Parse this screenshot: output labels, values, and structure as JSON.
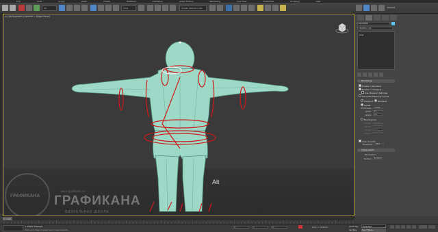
{
  "menu": {
    "items": [
      "Edit",
      "Tools",
      "Group",
      "Views",
      "Create",
      "Modifiers",
      "Animation",
      "Graph Editors",
      "Rendering",
      "Civil View",
      "Customize",
      "Scripting",
      "Help"
    ]
  },
  "toolbar": {
    "selection_filter": "All",
    "reference_coord": "View",
    "selection_set": "Create Selection Set",
    "workspace": "Default"
  },
  "viewport": {
    "label": "[+] [Orthographic] [Shaded + Edged Faces]",
    "hint_text": "Alt"
  },
  "watermark": {
    "circle_text": "ГРАФИКАНА",
    "url": "www.grafikana.ru",
    "brand": "ГРАФИКАНА",
    "subtitle": "ВИЗУАЛЬНАЯ ШКОЛА"
  },
  "command_panel": {
    "object_name": "Dude001",
    "object_color": "#59c0f0",
    "modifier_list": "Modifier List",
    "stack_item": "Line",
    "rendering_title": "Rendering",
    "enable_render": "Enable In Renderer",
    "enable_viewport": "Enable In Viewport",
    "use_viewport_settings": "Use Viewport Settings",
    "gen_mapping": "Generate Mapping Coords.",
    "viewport_radio": "Viewport",
    "renderer_radio": "Renderer",
    "radial": "Radial",
    "thickness_label": "Thickness:",
    "thickness_val": "1,0mm",
    "sides_label": "Sides:",
    "sides_val": "12",
    "angle_label": "Angle:",
    "angle_val": "0,0",
    "rectangular": "Rectangular",
    "length_label": "Length:",
    "length_val": "6,0mm",
    "width_label": "Width:",
    "width_val": "2,0mm",
    "angle2_label": "Angle:",
    "angle2_val": "0,0",
    "aspect_label": "Aspect:",
    "aspect_val": "3,0",
    "autosmooth": "Auto Smooth",
    "threshold_label": "Threshold:",
    "threshold_val": "40,0",
    "interpolation_title": "Interpolation",
    "interp_steps": "Steps:",
    "interp_steps_val": "6",
    "parameters_label": "Parameters",
    "radius_label": "Radius:",
    "radius_val": "60,0mm"
  },
  "timeline": {
    "slider": "0 / 100"
  },
  "status": {
    "left_box": "",
    "message": "1 Shape Selected",
    "hint": "Click and drag to select and move objects",
    "x": "X:",
    "y": "Y:",
    "z": "Z:",
    "grid": "Grid = 10,0mm",
    "autokey": "Auto Key",
    "selected": "Selected",
    "setkey": "Set Key",
    "keyfilters": "Key Filters..."
  }
}
